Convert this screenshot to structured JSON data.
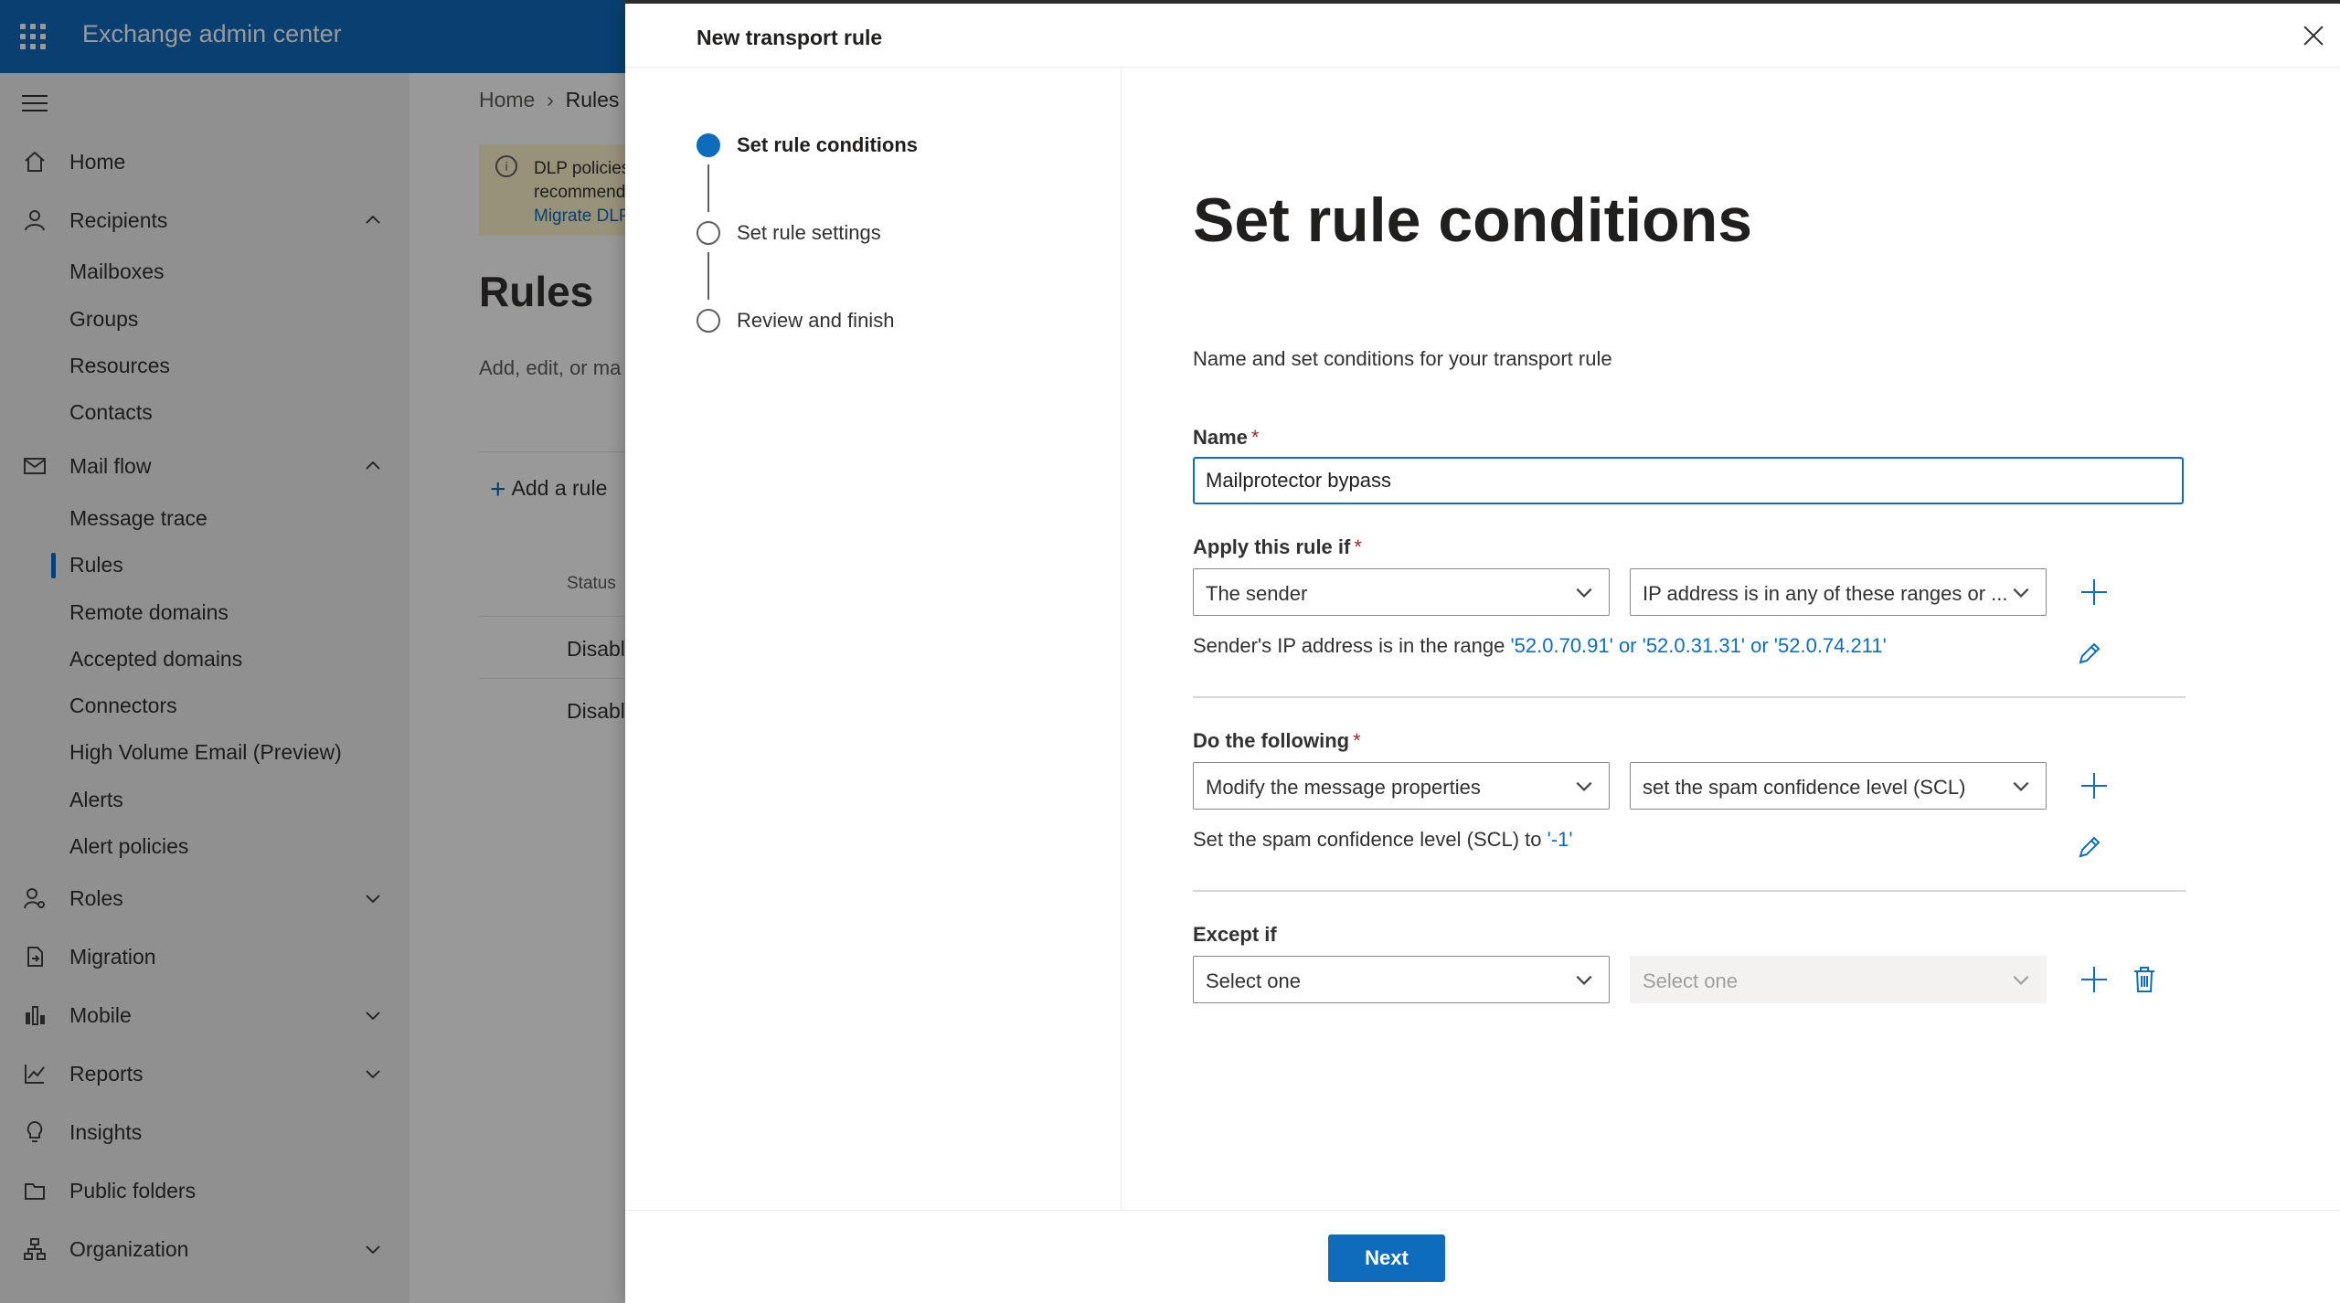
{
  "app": {
    "title": "Exchange admin center"
  },
  "nav": {
    "items": [
      {
        "label": "Home"
      },
      {
        "label": "Recipients"
      },
      {
        "label": "Mail flow"
      },
      {
        "label": "Roles"
      },
      {
        "label": "Migration"
      },
      {
        "label": "Mobile"
      },
      {
        "label": "Reports"
      },
      {
        "label": "Insights"
      },
      {
        "label": "Public folders"
      },
      {
        "label": "Organization"
      }
    ],
    "recipients_sub": [
      "Mailboxes",
      "Groups",
      "Resources",
      "Contacts"
    ],
    "mailflow_sub": [
      "Message trace",
      "Rules",
      "Remote domains",
      "Accepted domains",
      "Connectors",
      "High Volume Email (Preview)",
      "Alerts",
      "Alert policies"
    ]
  },
  "background": {
    "breadcrumb": {
      "home": "Home",
      "current": "Rules"
    },
    "banner": {
      "line1": "DLP policies",
      "line2": "recommend",
      "link": "Migrate DLP"
    },
    "title": "Rules",
    "description": "Add, edit, or ma",
    "add_rule": "Add a rule",
    "status_header": "Status",
    "rows": [
      "Disabl",
      "Disabl"
    ]
  },
  "panel": {
    "title": "New transport rule",
    "steps": [
      {
        "label": "Set rule conditions",
        "active": true
      },
      {
        "label": "Set rule settings",
        "active": false
      },
      {
        "label": "Review and finish",
        "active": false
      }
    ],
    "heading": "Set rule conditions",
    "description": "Name and set conditions for your transport rule",
    "name_label": "Name",
    "required_mark": "*",
    "name_value": "Mailprotector bypass",
    "apply_label": "Apply this rule if",
    "apply_select1": "The sender",
    "apply_select2": "IP address is in any of these ranges or ...",
    "apply_summary_prefix": "Sender's IP address is in the range ",
    "apply_summary_link": "'52.0.70.91' or '52.0.31.31' or '52.0.74.211'",
    "do_label": "Do the following",
    "do_select1": "Modify the message properties",
    "do_select2": "set the spam confidence level (SCL)",
    "do_summary_prefix": "Set the spam confidence level (SCL) to ",
    "do_summary_link": "'-1'",
    "except_label": "Except if",
    "except_select1": "Select one",
    "except_select2": "Select one",
    "next_label": "Next"
  },
  "colors": {
    "accent": "#0f6cbd",
    "required": "#a4262c"
  }
}
